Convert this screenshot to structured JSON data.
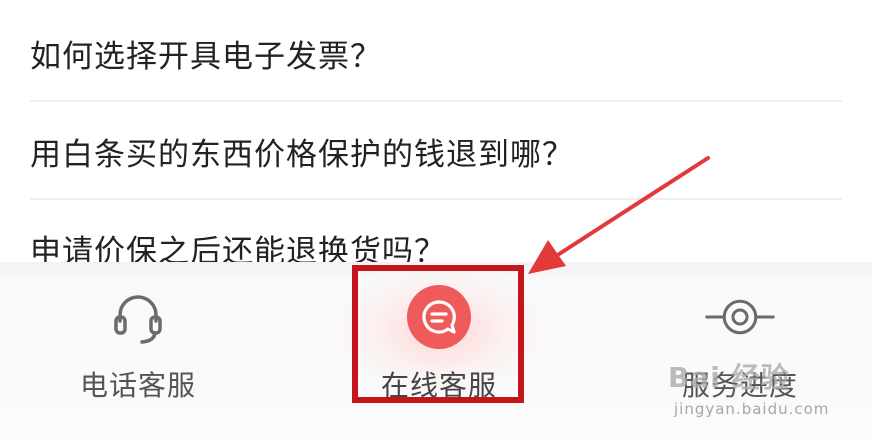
{
  "faq": {
    "items": [
      {
        "question": "如何选择开具电子发票？"
      },
      {
        "question": "用白条买的东西价格保护的钱退到哪？"
      },
      {
        "question": "申请价保之后还能退换货吗？"
      }
    ]
  },
  "bottom_nav": {
    "tabs": [
      {
        "label": "电话客服",
        "icon": "headset-icon"
      },
      {
        "label": "在线客服",
        "icon": "chat-bubble-icon",
        "active": true
      },
      {
        "label": "服务进度",
        "icon": "progress-target-icon"
      }
    ]
  },
  "annotation": {
    "highlight_color": "#c4151c",
    "arrow_color": "#e23a3a"
  },
  "watermark": {
    "logo": "Bai 经验",
    "url": "jingyan.baidu.com"
  },
  "colors": {
    "accent": "#ef5a5a",
    "text": "#222222",
    "label": "#555555",
    "divider": "#eeeeee"
  }
}
